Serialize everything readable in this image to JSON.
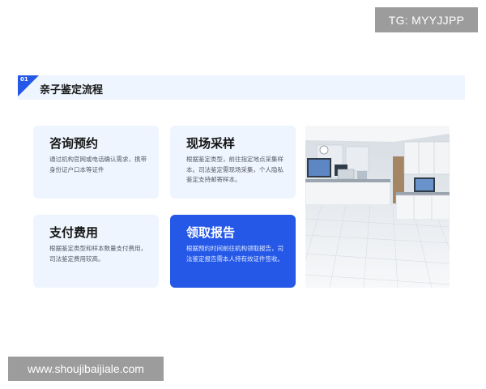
{
  "watermark_top": "TG: MYYJJPP",
  "watermark_bottom": "www.shoujibaijiale.com",
  "section": {
    "number": "01",
    "title": "亲子鉴定流程"
  },
  "cards": [
    {
      "title": "咨询预约",
      "text": "通过机构官网或电话确认需求，携带身份证户口本等证件"
    },
    {
      "title": "现场采样",
      "text": "根据鉴定类型，前往指定地点采集样本。司法鉴定需现场采集，个人隐私鉴定支持邮寄样本。"
    },
    {
      "title": "支付费用",
      "text": "根据鉴定类型和样本数量支付费用，司法鉴定费用较高。"
    },
    {
      "title": "领取报告",
      "text": "根据预约时间前往机构领取报告，司法鉴定报告需本人持有效证件签收。"
    }
  ],
  "colors": {
    "accent": "#2558e6",
    "card_bg": "#eef5fe"
  }
}
